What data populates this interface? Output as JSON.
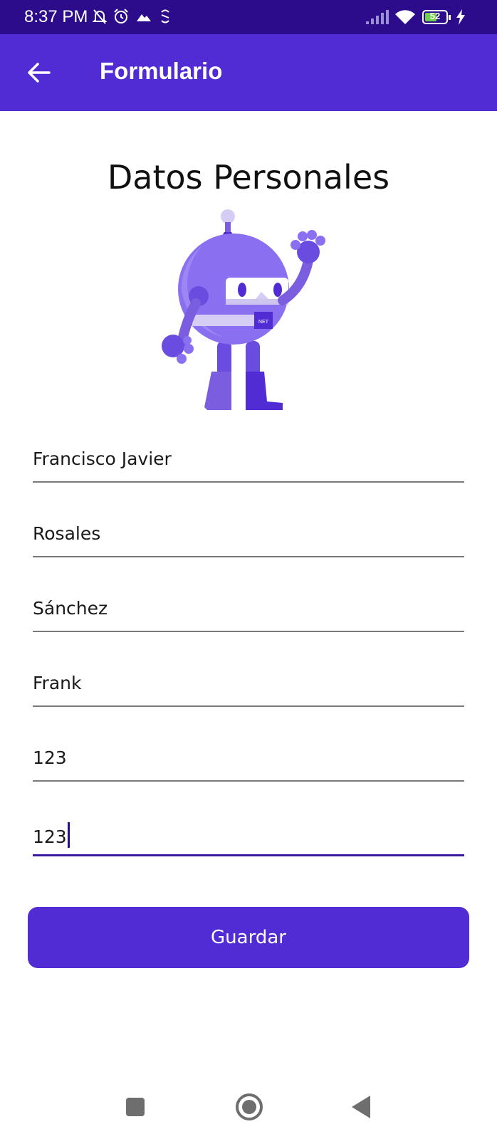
{
  "status_bar": {
    "time": "8:37 PM",
    "battery": "52",
    "icons": [
      "muted-bell-icon",
      "alarm-icon",
      "mountain-icon",
      "sync-icon",
      "signal-icon",
      "wifi-icon",
      "battery-icon",
      "charging-icon"
    ]
  },
  "app_bar": {
    "title": "Formulario",
    "back_icon": "back-arrow-icon"
  },
  "form": {
    "section_title": "Datos Personales",
    "fields": [
      {
        "value": "Francisco Javier"
      },
      {
        "value": "Rosales"
      },
      {
        "value": "Sánchez"
      },
      {
        "value": "Frank"
      },
      {
        "value": "123"
      },
      {
        "value": "123"
      }
    ],
    "save_label": "Guardar"
  },
  "nav_bar": {
    "icons": [
      "recents-icon",
      "home-icon",
      "back-icon"
    ]
  },
  "colors": {
    "status_bar": "#2d0c8c",
    "primary": "#512bd4",
    "focus_line": "#3a1a9e"
  }
}
